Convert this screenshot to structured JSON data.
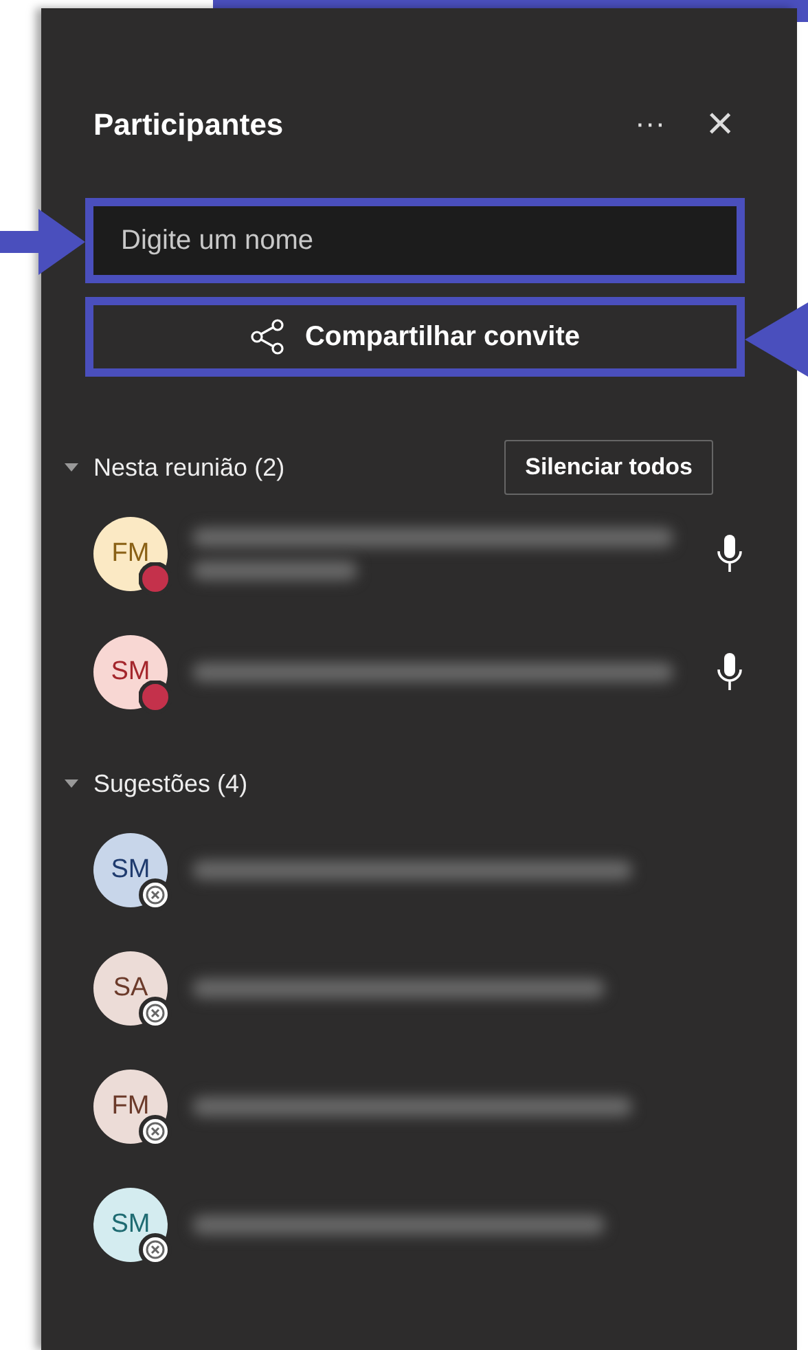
{
  "panel": {
    "title": "Participantes",
    "more": "···",
    "close": "×"
  },
  "search": {
    "placeholder": "Digite um nome",
    "highlighted": true
  },
  "share_button": {
    "label": "Compartilhar convite",
    "highlighted": true
  },
  "sections": [
    {
      "title": "Nesta reunião (2)",
      "expanded": true,
      "action": "Silenciar todos",
      "people": [
        {
          "initials": "FM",
          "color": "#fbe9c4",
          "kind": "busy",
          "mic": true,
          "subtitle": true
        },
        {
          "initials": "SM",
          "color": "#f8d7d3",
          "kind": "busy",
          "mic": true,
          "subtitle": false
        }
      ]
    },
    {
      "title": "Sugestões (4)",
      "expanded": true,
      "people": [
        {
          "initials": "SM",
          "color": "#c8d6ea",
          "kind": "offline",
          "mic": false,
          "subtitle": false
        },
        {
          "initials": "SA",
          "color": "#ecdcd7",
          "kind": "offline",
          "mic": false,
          "subtitle": false
        },
        {
          "initials": "FM",
          "color": "#ecdcd7",
          "kind": "offline",
          "mic": false,
          "subtitle": false
        },
        {
          "initials": "SM",
          "color": "#d4ecf0",
          "kind": "offline",
          "mic": false,
          "subtitle": false
        }
      ]
    }
  ]
}
